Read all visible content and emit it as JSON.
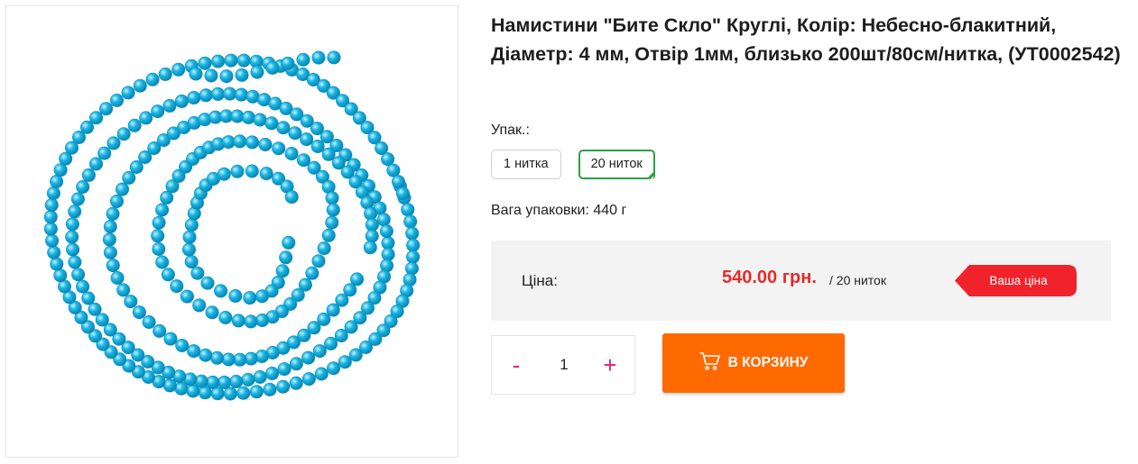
{
  "product": {
    "image_alt": "beads-strand",
    "title": "Намистини \"Бите Скло\" Круглі, Колір: Небесно-блакитний, Діаметр: 4 мм, Отвір 1мм, близько 200шт/80см/нитка, (УТ0002542)"
  },
  "packaging": {
    "label": "Упак.:",
    "options": [
      {
        "label": "1 нитка",
        "selected": false
      },
      {
        "label": "20 ниток",
        "selected": true
      }
    ]
  },
  "weight": {
    "label": "Вага упаковки:",
    "value": "440 г"
  },
  "price": {
    "label": "Ціна:",
    "value": "540.00 грн.",
    "unit": "/ 20 ниток",
    "badge": "Ваша ціна"
  },
  "quantity": {
    "minus": "-",
    "value": "1",
    "plus": "+"
  },
  "cart": {
    "label": "В КОРЗИНУ",
    "icon": "cart-icon"
  },
  "colors": {
    "accent_orange": "#ff6a00",
    "price_red": "#e52b2b",
    "selected_green": "#2aa144",
    "bead_blue": "#19b6e3",
    "qty_pink": "#e0207a"
  }
}
